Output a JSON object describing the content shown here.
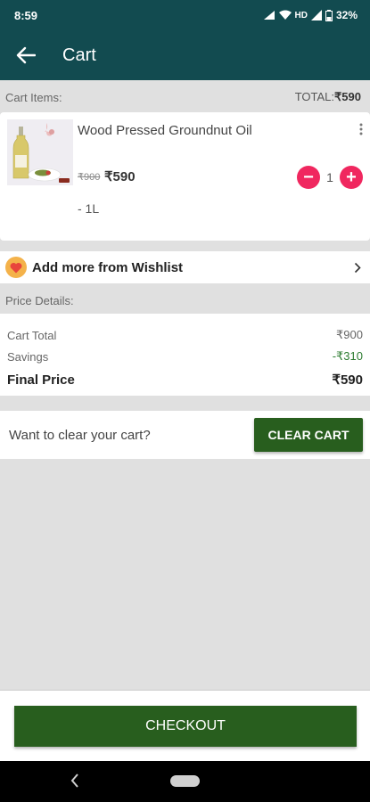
{
  "status_bar": {
    "time": "8:59",
    "network": "HD",
    "battery": "32%"
  },
  "app_bar": {
    "title": "Cart",
    "back_icon": "arrow-left-icon"
  },
  "cart_header": {
    "label": "Cart Items:",
    "total_prefix": "TOTAL:",
    "total_value": "₹590"
  },
  "cart_items": [
    {
      "name": "Wood Pressed Groundnut Oil",
      "original_price": "₹900",
      "price": "₹590",
      "quantity": "1",
      "variant": "- 1L",
      "decrement": "−",
      "increment": "+"
    }
  ],
  "wishlist": {
    "label": "Add more from Wishlist",
    "icon": "heart-icon",
    "chevron": "chevron-right-icon"
  },
  "price_details": {
    "label": "Price Details:",
    "rows": [
      {
        "label": "Cart Total",
        "value": "₹900"
      },
      {
        "label": "Savings",
        "value": "-₹310"
      }
    ],
    "final_label": "Final Price",
    "final_value": "₹590"
  },
  "clear_cart": {
    "prompt": "Want to clear your cart?",
    "button": "CLEAR CART"
  },
  "checkout": {
    "button": "CHECKOUT"
  },
  "colors": {
    "header": "#124b50",
    "primary_button": "#285e1e",
    "qty_button": "#f0275f",
    "savings": "#2e7d32"
  }
}
